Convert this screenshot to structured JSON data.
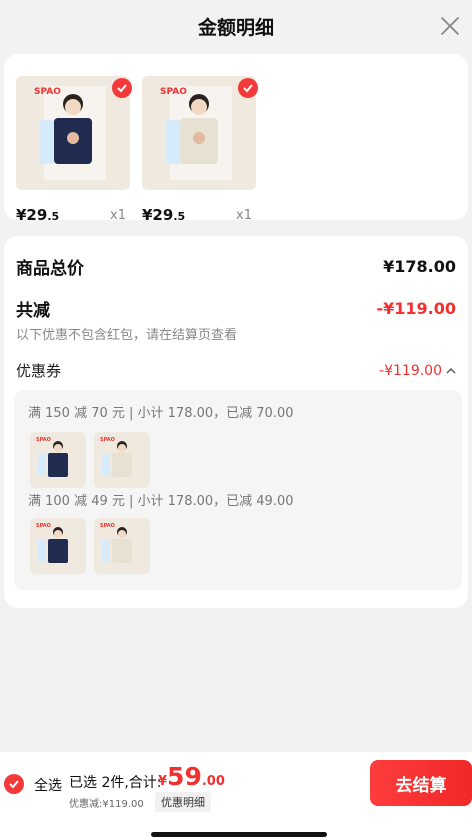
{
  "header": {
    "title": "金额明细",
    "close_icon": "close-icon"
  },
  "products": [
    {
      "price_main": "¥29",
      "price_decimal": ".5",
      "qty": "x1",
      "brand": "SPAO",
      "shirt_color": "#1f2b4f"
    },
    {
      "price_main": "¥29",
      "price_decimal": ".5",
      "qty": "x1",
      "brand": "SPAO",
      "shirt_color": "#e7e1d2"
    }
  ],
  "summary": {
    "total_label": "商品总价",
    "total_value": "¥178.00",
    "reduce_label": "共减",
    "reduce_value": "-¥119.00",
    "note": "以下优惠不包含红包，请在结算页查看",
    "coupon_label": "优惠券",
    "coupon_value": "-¥119.00"
  },
  "coupons": [
    {
      "title": "满 150 减 70 元 | 小计 178.00，已减 70.00"
    },
    {
      "title": "满 100 减 49 元 | 小计 178.00，已减 49.00"
    }
  ],
  "bottom": {
    "select_all": "全选",
    "selected_text": "已选 2件,合计:",
    "currency": "¥",
    "total_int": "59",
    "total_dec": ".00",
    "discount_text": "优惠减:¥119.00",
    "detail_label": "优惠明细",
    "checkout_label": "去结算"
  },
  "colors": {
    "accent": "#f23030",
    "navy_shirt": "#1f2b4f",
    "cream_shirt": "#e7e1d2"
  }
}
